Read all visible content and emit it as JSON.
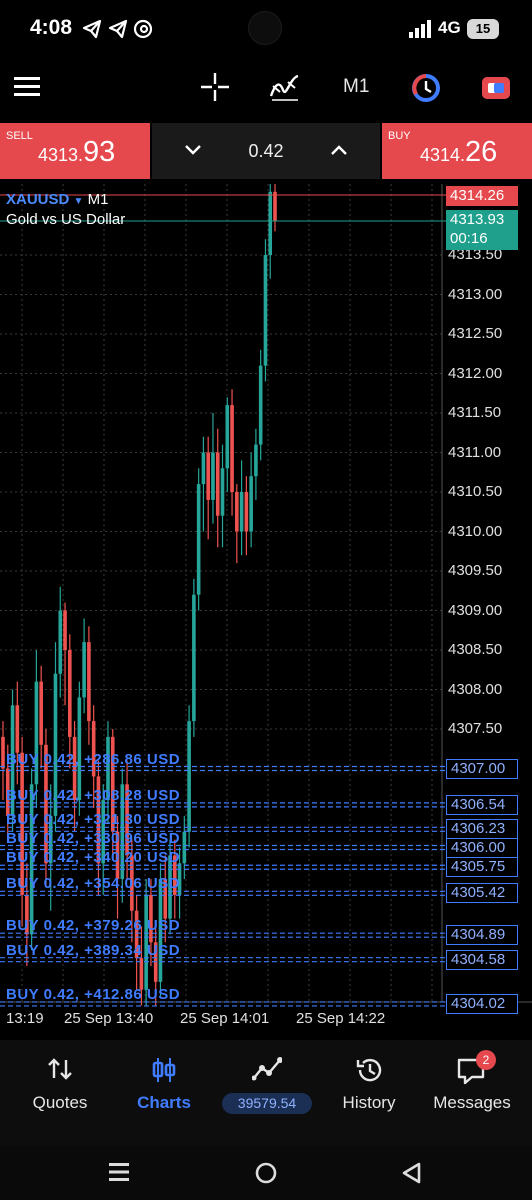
{
  "status_bar": {
    "time": "4:08",
    "network": "4G",
    "battery": "15"
  },
  "toolbar": {
    "timeframe": "M1",
    "icons": [
      "menu-icon",
      "crosshair-icon",
      "indicators-icon",
      "clock-icon",
      "trade-icon"
    ]
  },
  "trade_panel": {
    "sell": {
      "label": "SELL",
      "price_main": "4313.",
      "price_big": "93"
    },
    "buy": {
      "label": "BUY",
      "price_main": "4314.",
      "price_big": "26"
    },
    "volume": "0.42"
  },
  "chart": {
    "symbol": "XAUUSD",
    "timeframe": "M1",
    "description": "Gold vs US Dollar",
    "ask_price": "4314.26",
    "bid_price": "4313.93",
    "bid_timer": "00:16",
    "colors": {
      "bull": "#26a69a",
      "bear": "#ef5350",
      "order": "#3f7cff",
      "ask": "#e5484d",
      "bid": "#1fa08c"
    }
  },
  "chart_data": {
    "type": "candlestick",
    "y_ticks": [
      "4313.50",
      "4313.00",
      "4312.50",
      "4312.00",
      "4311.50",
      "4311.00",
      "4310.50",
      "4310.00",
      "4309.50",
      "4309.00",
      "4308.50",
      "4308.00",
      "4307.50"
    ],
    "x_ticks": [
      "13:19",
      "25 Sep 13:40",
      "25 Sep 14:01",
      "25 Sep 14:22"
    ],
    "ylim": [
      4304.0,
      4314.5
    ],
    "candles": [
      [
        4307.4,
        4307.0,
        4306.6,
        4307.6
      ],
      [
        4307.0,
        4306.4,
        4306.1,
        4307.3
      ],
      [
        4306.4,
        4307.8,
        4306.2,
        4308.0
      ],
      [
        4307.8,
        4307.2,
        4306.8,
        4308.1
      ],
      [
        4307.2,
        4305.4,
        4305.0,
        4307.4
      ],
      [
        4305.4,
        4304.9,
        4304.5,
        4305.8
      ],
      [
        4304.9,
        4306.8,
        4304.7,
        4307.0
      ],
      [
        4306.8,
        4308.1,
        4306.5,
        4308.5
      ],
      [
        4308.1,
        4307.3,
        4307.0,
        4308.3
      ],
      [
        4307.3,
        4305.8,
        4305.5,
        4307.5
      ],
      [
        4305.8,
        4306.4,
        4305.2,
        4306.8
      ],
      [
        4306.4,
        4308.2,
        4306.2,
        4308.6
      ],
      [
        4308.2,
        4309.0,
        4307.9,
        4309.3
      ],
      [
        4309.0,
        4308.5,
        4307.8,
        4309.1
      ],
      [
        4308.5,
        4307.4,
        4307.0,
        4308.7
      ],
      [
        4307.4,
        4306.6,
        4306.2,
        4307.6
      ],
      [
        4306.6,
        4307.9,
        4306.4,
        4308.1
      ],
      [
        4307.9,
        4308.6,
        4307.7,
        4308.9
      ],
      [
        4308.6,
        4307.6,
        4307.3,
        4308.8
      ],
      [
        4307.6,
        4306.9,
        4306.5,
        4307.8
      ],
      [
        4306.9,
        4305.8,
        4305.4,
        4307.1
      ],
      [
        4305.8,
        4306.6,
        4305.4,
        4306.8
      ],
      [
        4306.6,
        4307.4,
        4306.3,
        4307.6
      ],
      [
        4307.4,
        4306.2,
        4305.9,
        4307.5
      ],
      [
        4306.2,
        4305.6,
        4305.1,
        4306.4
      ],
      [
        4305.6,
        4306.8,
        4305.3,
        4307.0
      ],
      [
        4306.8,
        4305.9,
        4305.6,
        4307.1
      ],
      [
        4305.9,
        4305.2,
        4304.8,
        4306.1
      ],
      [
        4305.2,
        4304.6,
        4304.2,
        4305.4
      ],
      [
        4304.6,
        4304.2,
        4304.0,
        4305.0
      ],
      [
        4304.2,
        4305.4,
        4304.0,
        4305.6
      ],
      [
        4305.4,
        4304.8,
        4304.5,
        4305.6
      ],
      [
        4304.8,
        4304.3,
        4304.0,
        4305.0
      ],
      [
        4304.3,
        4305.6,
        4304.1,
        4305.8
      ],
      [
        4305.6,
        4305.1,
        4304.8,
        4305.9
      ],
      [
        4305.1,
        4305.9,
        4304.9,
        4306.1
      ],
      [
        4305.9,
        4305.4,
        4305.1,
        4306.1
      ],
      [
        4305.4,
        4305.8,
        4305.1,
        4306.0
      ],
      [
        4305.8,
        4306.2,
        4305.6,
        4306.4
      ],
      [
        4306.2,
        4307.6,
        4306.0,
        4307.8
      ],
      [
        4307.6,
        4309.2,
        4307.4,
        4309.4
      ],
      [
        4309.2,
        4310.6,
        4309.0,
        4310.8
      ],
      [
        4310.6,
        4311.0,
        4310.0,
        4311.2
      ],
      [
        4311.0,
        4310.4,
        4309.9,
        4311.2
      ],
      [
        4310.4,
        4311.0,
        4310.1,
        4311.5
      ],
      [
        4311.0,
        4310.2,
        4309.8,
        4311.3
      ],
      [
        4310.2,
        4310.8,
        4309.8,
        4311.1
      ],
      [
        4310.8,
        4311.6,
        4310.5,
        4311.7
      ],
      [
        4311.6,
        4310.5,
        4310.2,
        4311.8
      ],
      [
        4310.5,
        4310.0,
        4309.6,
        4310.6
      ],
      [
        4310.0,
        4310.5,
        4309.7,
        4310.9
      ],
      [
        4310.5,
        4310.0,
        4309.7,
        4310.7
      ],
      [
        4310.0,
        4310.7,
        4309.8,
        4311.0
      ],
      [
        4310.7,
        4311.1,
        4310.4,
        4311.3
      ],
      [
        4311.1,
        4312.1,
        4310.9,
        4312.3
      ],
      [
        4312.1,
        4313.5,
        4311.9,
        4313.7
      ],
      [
        4313.5,
        4314.3,
        4313.2,
        4314.5
      ],
      [
        4314.3,
        4313.93,
        4313.8,
        4314.4
      ]
    ]
  },
  "orders": [
    {
      "text": "BUY 0.42, +286.86 USD",
      "price": "4307.00"
    },
    {
      "text": "BUY 0.42, +308.28 USD",
      "price": "4306.54"
    },
    {
      "text": "BUY 0.42, +321.30 USD",
      "price": "4306.23"
    },
    {
      "text": "BUY 0.42, +330.96 USD",
      "price": "4306.00"
    },
    {
      "text": "BUY 0.42, +340.20 USD",
      "price": "4305.75"
    },
    {
      "text": "BUY 0.42, +354.06 USD",
      "price": "4305.42"
    },
    {
      "text": "BUY 0.42, +379.26 USD",
      "price": "4304.89"
    },
    {
      "text": "BUY 0.42, +389.34 USD",
      "price": "4304.58"
    },
    {
      "text": "BUY 0.42, +412.86 USD",
      "price": "4304.02"
    }
  ],
  "bottom_nav": {
    "quotes": "Quotes",
    "charts": "Charts",
    "balance": "39579.54",
    "history": "History",
    "messages": "Messages",
    "messages_badge": "2"
  }
}
